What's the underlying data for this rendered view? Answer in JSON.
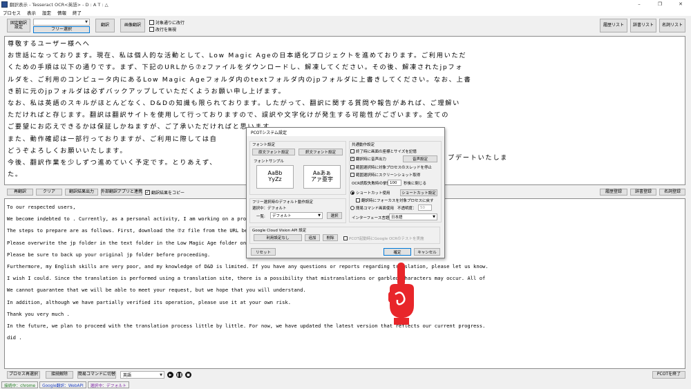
{
  "titlebar": {
    "title": "翻訳表示 - Tesseract OCR<英語> - D : A T : △",
    "minimize": "–",
    "restore": "❐",
    "close": "✕"
  },
  "menu": [
    "プロセス",
    "表示",
    "設定",
    "情報",
    "終了"
  ],
  "toolbar": {
    "region_fix": "固定翻訳\n設定",
    "region_select_value": "",
    "free_select": "フリー選択",
    "translate": "翻訳",
    "image_translate": "画像翻訳",
    "chk_target_only": "対象通りに改行",
    "chk_ignore_newline": "改行を無視",
    "history_list": "履歴リスト",
    "dict_list": "辞書リスト",
    "name_list": "名詞リスト"
  },
  "japanese_text": [
    "尊敬するユーザー様へへ",
    "お世話になっております。現在、私は個人的な活動として、Low Magic Ageの日本語化プロジェクトを進めております。ご利用いただ",
    "くための手順は以下の通りです。まず、下記のURLから⑦zファイルをダウンロードし、解凍してください。その後、解凍されたjpフォ",
    "ルダを、ご利用のコンピュータ内にあるLow Magic Ageフォルダ内のtextフォルダ内のjpフォルダに上書きしてください。なお、上書",
    "き前に元のjpフォルダは必ずバックアップしていただくようお願い申し上げます。",
    "なお、私は英語のスキルがほとんどなく、D&Dの知識も限られております。したがって、翻訳に関する質問や報告があれば、ご理解い",
    "ただければと存じます。翻訳は翻訳サイトを使用して行っておりますので、誤訳や文字化けが発生する可能性がございます。全ての",
    "ご要望にお応えできるかは保証しかねますが、ご了承いただければと思います。",
    "また、動作確認は一部行っておりますが、ご利用に際しては自",
    "どうぞよろしくお願いいたします。",
    "今後、翻訳作業を少しずつ進めていく予定です。とりあえず、",
    "た。"
  ],
  "jp_tail_right": "プデートいたしま",
  "mid_toolbar": {
    "retranslate": "再翻訳",
    "clear": "クリア",
    "export": "翻訳結果出力",
    "external": "外部翻訳アプリと連携",
    "chk_copy": "翻訳結果をコピー",
    "history_reg": "履歴登録",
    "dict_reg": "辞書登録",
    "name_reg": "名詞登録"
  },
  "english_text": [
    "To our respected users,",
    "We become indebted to . Currently, as a personal activity, I am working on a projec",
    "The steps to prepare are as follows. First, download the ⑦z file from the URL belo",
    "Please overwrite the jp folder in the text folder in the Low Magic Age folder on yo",
    "Please be sure to back up your original jp folder before proceeding.",
    "Furthermore, my English skills are very poor, and my knowledge of D&D is limited. If you have any questions or reports regarding translation, please let us know.",
    "I wish I could. Since the translation is performed using a translation site, there is a possibility that mistranslations or garbled characters may occur. All of",
    "We cannot guarantee that we will be able to meet your request, but we hope that you will understand.",
    "In addition, although we have partially verified its operation, please use it at your own risk.",
    "Thank you very much .",
    "In the future, we plan to proceed with the translation process little by little. For now, we have updated the latest version that reflects our current progress.",
    "did ."
  ],
  "bottom": {
    "process_reselect": "プロセス再選択",
    "disconnect": "接続解除",
    "simple_cmd": "簡易コマンドに切替",
    "language": "英語",
    "pcot_end": "PCOTを終了"
  },
  "statusbar": {
    "connecting": "接続中：chrome",
    "google": "Google翻訳：WebAPI",
    "selecting": "選択中：デフォルト"
  },
  "colors": {
    "status_connecting": "#1e7a1e",
    "status_google": "#1d3fbf",
    "status_selecting": "#7a1fa2",
    "hand": "#e8262a"
  },
  "dialog": {
    "title": "PCOTシステム設定",
    "font_settings": "フォント設定",
    "orig_font_btn": "原文フォント設定",
    "trans_font_btn": "訳文フォント設定",
    "font_sample": "フォントサンプル",
    "sample1": "AaBb\nYyZz",
    "sample2": "Aaあぁ\nアァ亜宇",
    "free_select_default": "フリー選択時のデフォルト動作設定",
    "selecting": "選択中：デフォルト",
    "list_label": "一覧:",
    "list_value": "デフォルト",
    "select_btn": "選択",
    "gcv": "Google Cloud Vision API 設定",
    "gcv_value": "利用設定なし",
    "add": "追加",
    "delete": "削除",
    "gcv_test": "PCOT起動時にGoogle OCRのテストを実施",
    "reset": "リセット",
    "common": "共通動作設定",
    "c1": "終了時に画面の座標とサイズを記憶",
    "c2": "翻訳時に音声出力",
    "voice_btn": "音声設定",
    "c3": "範囲選択時に対象プロセスのスレッドを停止",
    "c4": "範囲選択時にスクリーンショット取得",
    "ocr_label": "OCR読取失敗時の挙動：",
    "ocr_value": "100",
    "ocr_suffix": "秒後に閉じる",
    "shortcut_use": "ショートカット使用",
    "shortcut_btn": "ショートカット設定",
    "focus_return": "翻訳時にフォーカスを対象プロセスに戻す",
    "simple_use": "簡易コマンド画面使用",
    "opacity_label": "不透明度：",
    "opacity_value": "50",
    "ui_lang_label": "インターフェース言語：",
    "ui_lang_value": "日本語",
    "ok": "確定",
    "cancel": "キャンセル"
  }
}
